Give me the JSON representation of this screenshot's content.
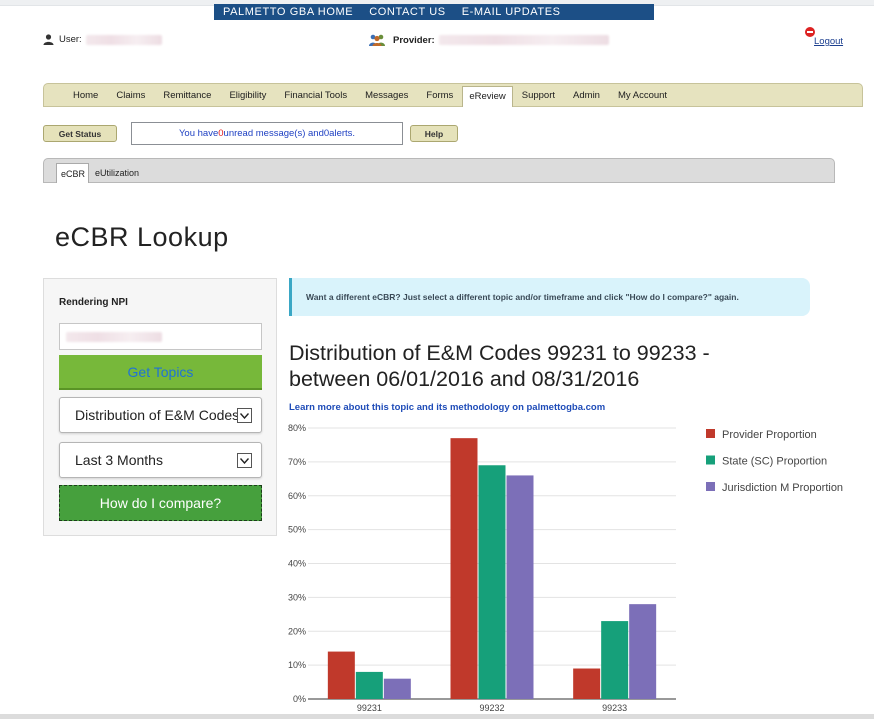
{
  "topnav": {
    "items": [
      "PALMETTO GBA HOME",
      "CONTACT US",
      "E-MAIL UPDATES"
    ]
  },
  "user": {
    "label": "User:",
    "provider_label": "Provider:",
    "logout": "Logout"
  },
  "mainnav": {
    "items": [
      "Home",
      "Claims",
      "Remittance",
      "Eligibility",
      "Financial Tools",
      "Messages",
      "Forms",
      "eReview",
      "Support",
      "Admin",
      "My Account"
    ],
    "active": "eReview"
  },
  "status": {
    "get_status": "Get Status",
    "msg_prefix": "You have ",
    "unread_count": "0",
    "msg_mid": " unread message(s) and ",
    "alert_count": "0",
    "msg_suffix": " alerts.",
    "help": "Help"
  },
  "subnav": {
    "tabs": [
      "eCBR",
      "eUtilization"
    ],
    "active": "eCBR"
  },
  "page": {
    "title": "eCBR Lookup"
  },
  "form": {
    "npi_label": "Rendering NPI",
    "get_topics": "Get Topics",
    "topic_value": "Distribution of E&M Codes",
    "timeframe_value": "Last 3 Months",
    "compare": "How do I compare?"
  },
  "info": {
    "text": "Want a different eCBR? Just select a different topic and/or timeframe and click \"How do I compare?\" again."
  },
  "report": {
    "title": "Distribution of E&M Codes 99231 to 99233 - between 06/01/2016 and 08/31/2016",
    "learn_more": "Learn more about this topic and its methodology on palmettogba.com"
  },
  "chart_data": {
    "type": "bar",
    "categories": [
      "99231",
      "99232",
      "99233"
    ],
    "series": [
      {
        "name": "Provider Proportion",
        "color": "#c0392b",
        "values": [
          14,
          77,
          9
        ]
      },
      {
        "name": "State (SC) Proportion",
        "color": "#16a07a",
        "values": [
          8,
          69,
          23
        ]
      },
      {
        "name": "Jurisdiction M Proportion",
        "color": "#7c6fb8",
        "values": [
          6,
          66,
          28
        ]
      }
    ],
    "yticks": [
      "0%",
      "10%",
      "20%",
      "30%",
      "40%",
      "50%",
      "60%",
      "70%",
      "80%"
    ],
    "ylim": [
      0,
      80
    ],
    "grid": true,
    "legend": "right"
  }
}
